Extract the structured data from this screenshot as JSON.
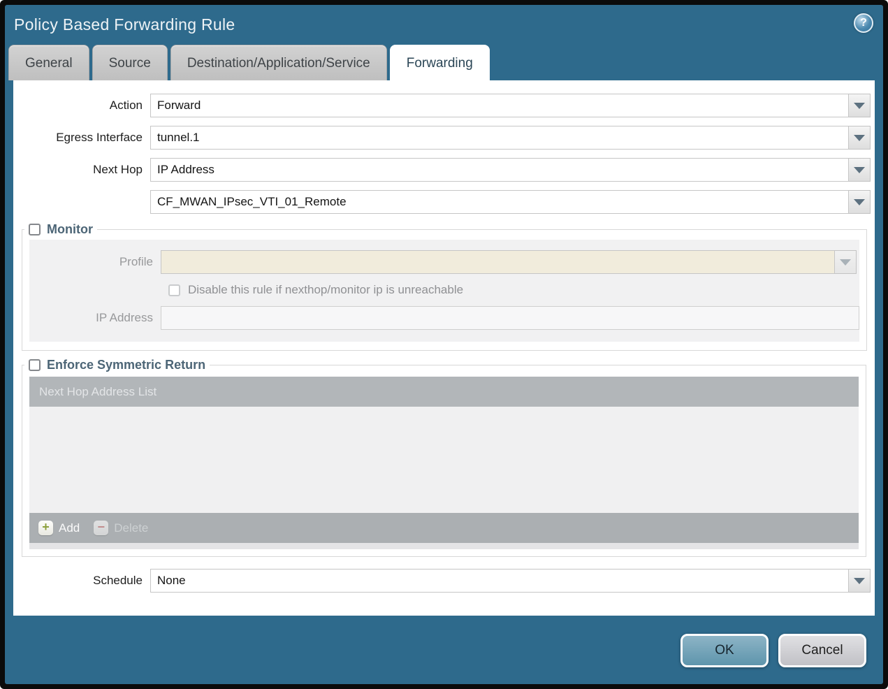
{
  "dialog": {
    "title": "Policy Based Forwarding Rule",
    "help_glyph": "?"
  },
  "tabs": [
    {
      "label": "General",
      "active": false
    },
    {
      "label": "Source",
      "active": false
    },
    {
      "label": "Destination/Application/Service",
      "active": false
    },
    {
      "label": "Forwarding",
      "active": true
    }
  ],
  "form": {
    "action": {
      "label": "Action",
      "value": "Forward"
    },
    "egress_interface": {
      "label": "Egress Interface",
      "value": "tunnel.1"
    },
    "next_hop": {
      "label": "Next Hop",
      "value": "IP Address"
    },
    "next_hop_address": {
      "value": "CF_MWAN_IPsec_VTI_01_Remote"
    },
    "schedule": {
      "label": "Schedule",
      "value": "None"
    }
  },
  "monitor": {
    "label": "Monitor",
    "checked": false,
    "profile": {
      "label": "Profile",
      "value": ""
    },
    "disable_rule": {
      "label": "Disable this rule if nexthop/monitor ip is unreachable",
      "checked": false
    },
    "ip_address": {
      "label": "IP Address",
      "value": ""
    }
  },
  "symmetric_return": {
    "label": "Enforce Symmetric Return",
    "checked": false,
    "table": {
      "header": "Next Hop Address List",
      "rows": []
    },
    "add_label": "Add",
    "add_glyph": "+",
    "delete_label": "Delete",
    "delete_glyph": "−"
  },
  "footer": {
    "ok_label": "OK",
    "cancel_label": "Cancel"
  },
  "colors": {
    "titlebar_teal": "#2e6a8c",
    "ok_button": "#6ba2b9",
    "section_label": "#4c6576",
    "table_header_bg": "#b2b6b9",
    "disabled_field_beige": "#f1ecdc"
  }
}
